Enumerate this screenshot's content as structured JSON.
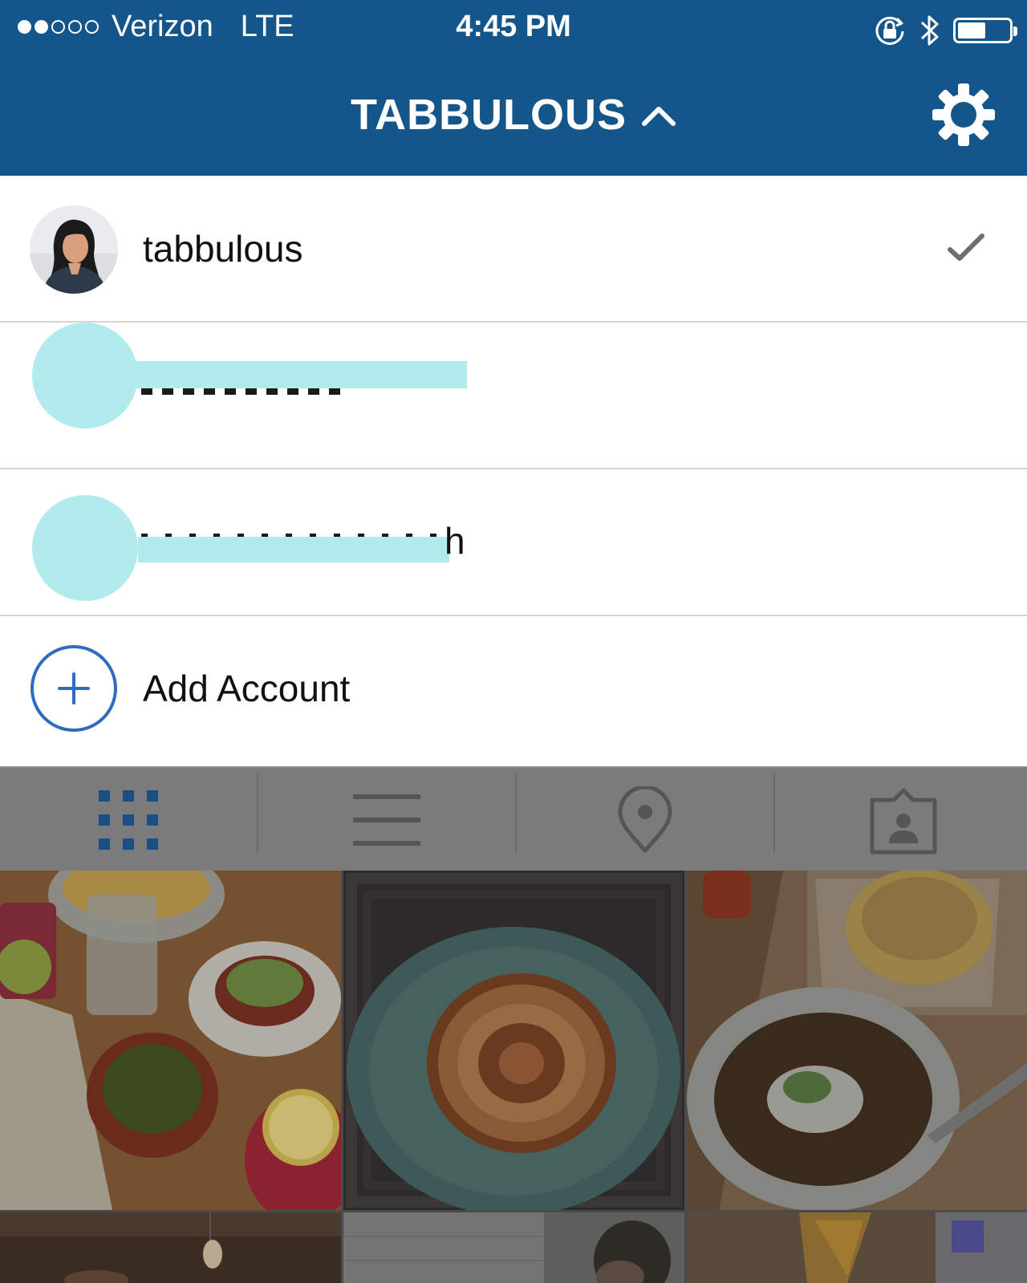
{
  "status_bar": {
    "carrier": "Verizon",
    "network": "LTE",
    "time": "4:45 PM",
    "signal_bars": 2,
    "signal_total": 5,
    "battery_level": 0.55,
    "icons": [
      "rotation-lock-icon",
      "bluetooth-icon",
      "battery-icon"
    ]
  },
  "nav": {
    "title": "TABBULOUS",
    "title_icon": "chevron-up-icon",
    "settings_icon": "gear-icon"
  },
  "accounts": [
    {
      "username": "tabbulous",
      "selected": true
    },
    {
      "username": "",
      "redacted": true
    },
    {
      "username": "h",
      "redacted": true
    }
  ],
  "add_account": {
    "label": "Add Account",
    "icon": "plus-circle-icon"
  },
  "tabs": [
    {
      "icon": "grid-icon",
      "active": true
    },
    {
      "icon": "list-icon",
      "active": false
    },
    {
      "icon": "location-pin-icon",
      "active": false
    },
    {
      "icon": "tagged-person-icon",
      "active": false
    }
  ],
  "colors": {
    "header": "#14558a",
    "accent_blue": "#2f6bbf",
    "redaction": "#b2ebeb",
    "overlay_tab_bar": "#7b7b7b"
  },
  "photos": [
    {
      "subject": "chips-salsa-drinks"
    },
    {
      "subject": "meringue-pie-plate"
    },
    {
      "subject": "soup-bowl-mac-and-cheese"
    },
    {
      "subject": "restaurant-lights"
    },
    {
      "subject": "window-person"
    },
    {
      "subject": "cheese-snack"
    }
  ]
}
